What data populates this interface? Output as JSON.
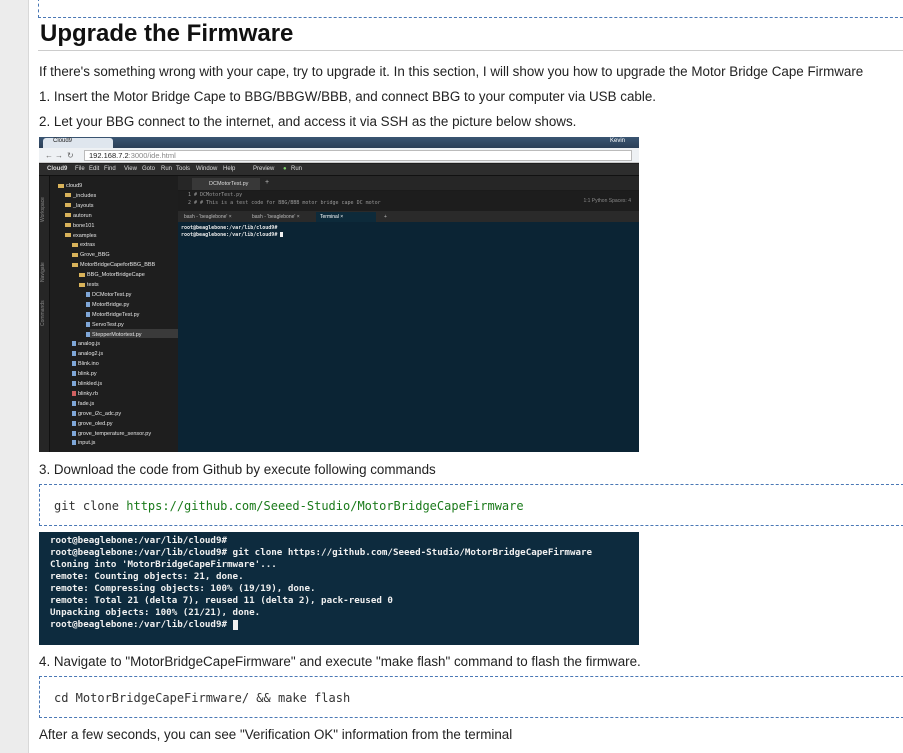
{
  "heading": "Upgrade the Firmware",
  "intro": "If there's something wrong with your cape, try to upgrade it. In this section, I will show you how to upgrade the Motor Bridge Cape Firmware",
  "step1": "1. Insert the Motor Bridge Cape to BBG/BBGW/BBB, and connect BBG to your computer via USB cable.",
  "step2": "2. Let your BBG connect to the internet, and access it via SSH as the picture below shows.",
  "step3": "3. Download the code from Github by execute following commands",
  "step4": "4. Navigate to \"MotorBridgeCapeFirmware\" and execute \"make flash\" command to flash the firmware.",
  "after": "After a few seconds, you can see \"Verification OK\" information from the terminal",
  "code1": {
    "prefix": "git clone ",
    "url": "https://github.com/Seeed-Studio/MotorBridgeCapeFirmware"
  },
  "code2": "cd MotorBridgeCapeFirmware/ && make flash",
  "ide": {
    "browser_tab": "Cloud9",
    "user": "Kevin",
    "address_host": "192.168.7.2",
    "address_rest": ":3000/ide.html",
    "menu": [
      "Cloud9",
      "File",
      "Edit",
      "Find",
      "View",
      "Goto",
      "Run",
      "Tools",
      "Window",
      "Help",
      "Preview",
      "Run"
    ],
    "side_labels": [
      "Workspace",
      "Navigate",
      "Commands"
    ],
    "tree": [
      {
        "label": "cloud9",
        "type": "folder",
        "indent": 0
      },
      {
        "label": "_includes",
        "type": "folder",
        "indent": 1
      },
      {
        "label": "_layouts",
        "type": "folder",
        "indent": 1
      },
      {
        "label": "autorun",
        "type": "folder",
        "indent": 1
      },
      {
        "label": "bone101",
        "type": "folder",
        "indent": 1
      },
      {
        "label": "examples",
        "type": "folder",
        "indent": 1
      },
      {
        "label": "extras",
        "type": "folder",
        "indent": 2
      },
      {
        "label": "Grove_BBG",
        "type": "folder",
        "indent": 2
      },
      {
        "label": "MotorBridgeCapeforBBG_BBB",
        "type": "folder",
        "indent": 2
      },
      {
        "label": "BBG_MotorBridgeCape",
        "type": "folder",
        "indent": 3
      },
      {
        "label": "tests",
        "type": "folder",
        "indent": 3
      },
      {
        "label": "DCMotorTest.py",
        "type": "file",
        "indent": 4
      },
      {
        "label": "MotorBridge.py",
        "type": "file",
        "indent": 4
      },
      {
        "label": "MotorBridgeTest.py",
        "type": "file",
        "indent": 4
      },
      {
        "label": "ServoTest.py",
        "type": "file",
        "indent": 4
      },
      {
        "label": "StepperMotortest.py",
        "type": "file",
        "indent": 4
      },
      {
        "label": "analog.js",
        "type": "file",
        "indent": 2
      },
      {
        "label": "analog2.js",
        "type": "file",
        "indent": 2
      },
      {
        "label": "Blink.ino",
        "type": "file",
        "indent": 2
      },
      {
        "label": "blink.py",
        "type": "file",
        "indent": 2
      },
      {
        "label": "blinkled.js",
        "type": "file",
        "indent": 2
      },
      {
        "label": "blinky.rb",
        "type": "file-red",
        "indent": 2
      },
      {
        "label": "fade.js",
        "type": "file",
        "indent": 2
      },
      {
        "label": "grove_i2c_adc.py",
        "type": "file",
        "indent": 2
      },
      {
        "label": "grove_oled.py",
        "type": "file",
        "indent": 2
      },
      {
        "label": "grove_temperature_sensor.py",
        "type": "file",
        "indent": 2
      },
      {
        "label": "input.js",
        "type": "file",
        "indent": 2
      }
    ],
    "editor_tab": "DCMotorTest.py",
    "editor_lines": [
      "1  # DCMotorTest.py",
      "2  # # This is a test code  for BBG/BBB motor bridge cape DC motor"
    ],
    "editor_status": "1:1    Python    Spaces: 4",
    "term_tabs": [
      "bash - 'beaglebone'  ×",
      "bash - 'beaglebone'  ×",
      "Terminal  ×",
      "+"
    ],
    "term_lines": [
      "root@beaglebone:/var/lib/cloud9#",
      "root@beaglebone:/var/lib/cloud9# "
    ]
  },
  "terminal2": [
    "root@beaglebone:/var/lib/cloud9#",
    "root@beaglebone:/var/lib/cloud9# git clone https://github.com/Seeed-Studio/MotorBridgeCapeFirmware",
    "Cloning into 'MotorBridgeCapeFirmware'...",
    "remote: Counting objects: 21, done.",
    "remote: Compressing objects: 100% (19/19), done.",
    "remote: Total 21 (delta 7), reused 11 (delta 2), pack-reused 0",
    "Unpacking objects: 100% (21/21), done.",
    "root@beaglebone:/var/lib/cloud9# "
  ]
}
